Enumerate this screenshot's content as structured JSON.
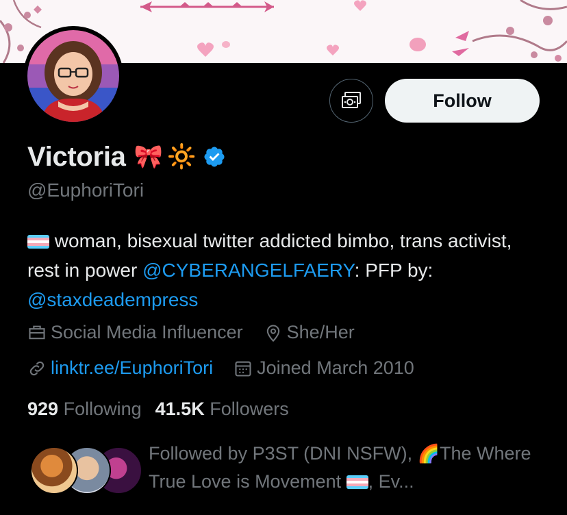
{
  "profile": {
    "name": "Victoria",
    "name_emojis": [
      "🎀",
      "🔆"
    ],
    "handle": "@EuphoriTori",
    "verified": true
  },
  "actions": {
    "follow_label": "Follow",
    "subscribe_icon": "money-icon"
  },
  "bio": {
    "part1": "woman, bisexual twitter addicted bimbo, trans activist, rest in power ",
    "mention1": "@CYBERANGELFAERY",
    "part2": ": PFP by: ",
    "mention2": "@staxdeadempress"
  },
  "meta": {
    "profession": "Social Media Influencer",
    "pronouns": "She/Her",
    "website": "linktr.ee/EuphoriTori",
    "joined": "Joined March 2010"
  },
  "stats": {
    "following_count": "929",
    "following_label": "Following",
    "followers_count": "41.5K",
    "followers_label": "Followers"
  },
  "followed_by": {
    "prefix": "Followed by P3ST (DNI NSFW), ",
    "middle": "The Where True Love is Movement ",
    "suffix": ", Ev..."
  },
  "colors": {
    "background": "#000000",
    "text": "#e7e9ea",
    "secondary": "#71767b",
    "link": "#1d9bf0",
    "button_bg": "#eff3f4"
  }
}
